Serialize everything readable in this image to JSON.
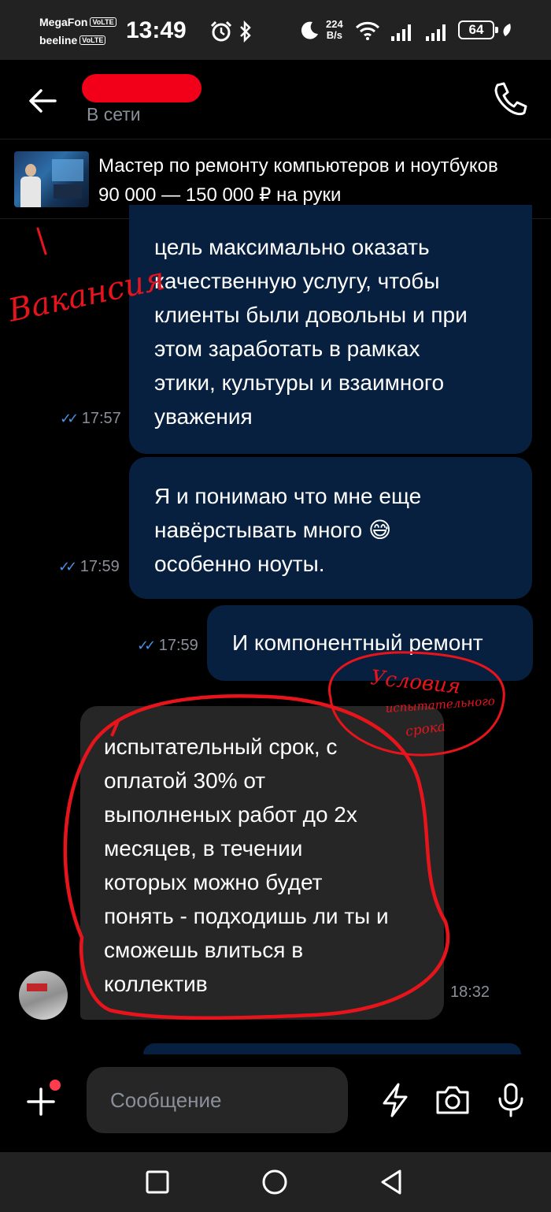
{
  "status_bar": {
    "carrier1": "MegaFon",
    "carrier2": "beeline",
    "volte": "VoLTE",
    "time": "13:49",
    "net_speed_value": "224",
    "net_speed_unit": "B/s",
    "battery": "64"
  },
  "header": {
    "contact_name": "redacted",
    "status": "В сети"
  },
  "vacancy": {
    "title": "Мастер по ремонту компьютеров и ноутбуков",
    "salary": "90 000 — 150 000 ₽ на руки"
  },
  "messages": [
    {
      "direction": "outgoing",
      "lines": [
        "цель максимально оказать",
        "качественную услугу, чтобы",
        "клиенты были довольны  и  при",
        "этом заработать в рамках",
        "этики, культуры и взаимного",
        "уважения"
      ],
      "time": "17:57",
      "read": true
    },
    {
      "direction": "outgoing",
      "lines": [
        "Я и понимаю что мне еще",
        "навёрстывать много 😅",
        "особенно ноуты."
      ],
      "time": "17:59",
      "read": true
    },
    {
      "direction": "outgoing",
      "lines": [
        "И компонентный ремонт"
      ],
      "time": "17:59",
      "read": true
    },
    {
      "direction": "incoming",
      "lines": [
        "испытательный срок, с",
        "оплатой 30% от",
        "выполненых работ до 2х",
        "месяцев, в течении",
        "которых можно будет",
        "понять - подходишь ли ты и",
        "сможешь влиться в",
        "коллектив"
      ],
      "time": "18:32"
    }
  ],
  "annotations": {
    "number": "1",
    "vacancy_label": "Вакансия",
    "conditions_line1": "Условия",
    "conditions_line2": "испытательного",
    "conditions_line3": "срока",
    "color": "#e8141c"
  },
  "input": {
    "placeholder": "Сообщение"
  },
  "colors": {
    "outgoing_bubble": "#07203f",
    "incoming_bubble": "#262626",
    "read_check": "#4a90e2",
    "meta_text": "#8a8f99"
  }
}
